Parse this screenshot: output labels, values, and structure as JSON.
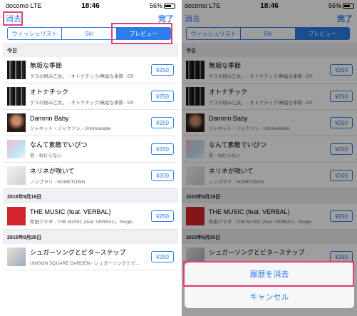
{
  "status": {
    "carrier": "docomo  LTE",
    "time": "18:46",
    "battery": "56%"
  },
  "nav": {
    "clear_label": "消去",
    "done_label": "完了"
  },
  "segments": [
    "ウィッシュリスト",
    "Siri",
    "プレビュー"
  ],
  "sections": {
    "today": "今日",
    "d1": "2015年9月19日",
    "d2": "2015年8月26日"
  },
  "items": [
    {
      "title": "無垢な季節",
      "subtitle": "ゲスの極み乙女。 - オトナチック/無垢な季節 - EP",
      "price": "¥250",
      "art": "grunge-art-icon"
    },
    {
      "title": "オトナチック",
      "subtitle": "ゲスの極み乙女。 - オトナチック/無垢な季節 - EP",
      "price": "¥250",
      "art": "grunge-art-icon"
    },
    {
      "title": "Dammn Baby",
      "subtitle": "ジャネット・ジャクソン - Unbreakable",
      "price": "¥250",
      "art": "portrait-art-icon"
    },
    {
      "title": "なんて素敵でいぴつ",
      "subtitle": "熊 - ねむらない",
      "price": "¥250",
      "art": "pastel-art-icon"
    },
    {
      "title": "ネリネが咲いて",
      "subtitle": "ノンブラリ - HOMETOWN",
      "price": "¥200",
      "art": "sketch-art-icon"
    },
    {
      "title": "THE MUSIC (feat. VERBAL)",
      "subtitle": "和田アキ子 - THE MUSIC (feat. VERBAL) - Single",
      "price": "¥250",
      "art": "red-art-icon"
    },
    {
      "title": "シュガーソングとビターステップ",
      "subtitle": "UNISON SQUARE GARDEN - シュガーソングとビ...",
      "price": "¥250",
      "art": "band-art-icon"
    }
  ],
  "sheet": {
    "clear_history": "履歴を消去",
    "cancel": "キャンセル"
  },
  "colors": {
    "accent": "#2b7de9",
    "highlight": "#e83e79",
    "section_bg": "#efeff4"
  }
}
